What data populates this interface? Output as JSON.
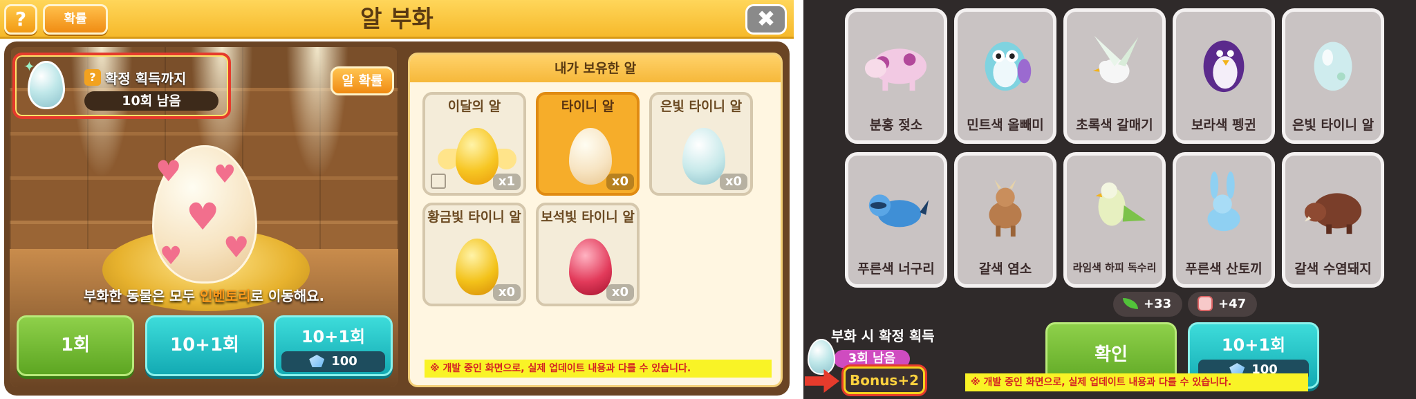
{
  "left": {
    "help_label": "?",
    "prob_label": "확률",
    "title": "알 부화",
    "close_label": "✖",
    "guarantee": {
      "question": "?",
      "label": "확정 획득까지",
      "count": "10회 남음"
    },
    "egg_prob_label": "알 확률",
    "move_text_pre": "부화한 동물은 모두 ",
    "move_text_hl": "인벤토리",
    "move_text_post": "로 이동해요.",
    "buttons": {
      "once": "1회",
      "ten_plus_one": "10+1회",
      "ten_plus_one_cost_title": "10+1회",
      "cost": "100"
    },
    "inventory": {
      "title": "내가 보유한 알",
      "eggs": [
        {
          "name": "이달의 알",
          "count": "x1"
        },
        {
          "name": "타이니 알",
          "count": "x0"
        },
        {
          "name": "은빛 타이니 알",
          "count": "x0"
        },
        {
          "name": "황금빛 타이니 알",
          "count": "x0"
        },
        {
          "name": "보석빛 타이니 알",
          "count": "x0"
        }
      ]
    },
    "notice": "※ 개발 중인 화면으로, 실제 업데이트 내용과 다를 수 있습니다."
  },
  "right": {
    "animals": [
      {
        "name": "분홍 젖소",
        "icon": "cow-icon"
      },
      {
        "name": "민트색 올빼미",
        "icon": "owl-icon"
      },
      {
        "name": "초록색 갈매기",
        "icon": "seagull-icon"
      },
      {
        "name": "보라색 펭귄",
        "icon": "penguin-icon"
      },
      {
        "name": "은빛 타이니 알",
        "icon": "egg-icon"
      },
      {
        "name": "푸른색 너구리",
        "icon": "raccoon-icon"
      },
      {
        "name": "갈색 염소",
        "icon": "goat-icon"
      },
      {
        "name": "라임색 하피 독수리",
        "icon": "eagle-icon"
      },
      {
        "name": "푸른색 산토끼",
        "icon": "hare-icon"
      },
      {
        "name": "갈색 수염돼지",
        "icon": "boar-icon"
      }
    ],
    "rewards": [
      {
        "value": "+33"
      },
      {
        "value": "+47"
      }
    ],
    "guarantee_label": "부화 시 확정 획득",
    "guarantee_count": "3회 남음",
    "bonus": "Bonus+2",
    "confirm_label": "확인",
    "ten_plus_one": "10+1회",
    "cost": "100",
    "notice": "※ 개발 중인 화면으로, 실제 업데이트 내용과 다를 수 있습니다."
  },
  "colors": {
    "accent_yellow": "#f6b92b",
    "green_button": "#5da622",
    "teal_button": "#13aab3",
    "notice_bg": "#f9f326",
    "notice_text": "#d42323",
    "highlight_red": "#e53b2c"
  }
}
